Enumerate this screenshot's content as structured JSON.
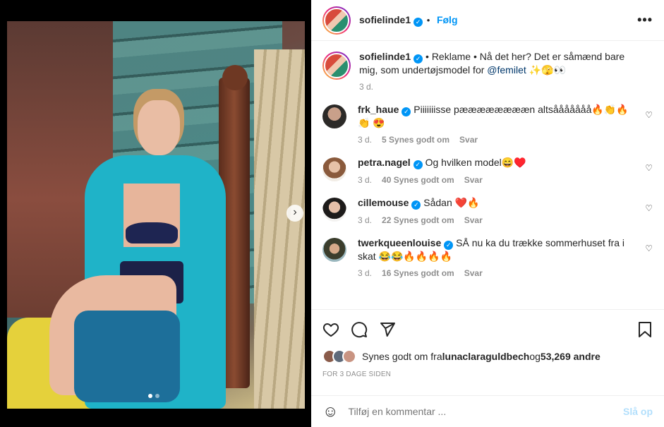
{
  "post": {
    "author": "sofielinde1",
    "follow_label": "Følg",
    "more_label": "•••",
    "caption_prefix": "• Reklame • Nå det her? Det er såmænd bare mig, som undertøjsmodel for ",
    "caption_mention": "@femilet",
    "caption_suffix": " ✨🫣👀",
    "caption_time": "3 d."
  },
  "comments": [
    {
      "user": "frk_haue",
      "text": "Piiiiiiisse pææææææææn altsååååååå🔥👏🔥👏 😍",
      "time": "3 d.",
      "likes": "5 Synes godt om",
      "reply": "Svar"
    },
    {
      "user": "petra.nagel",
      "text": "Og hvilken model😄♥️",
      "time": "3 d.",
      "likes": "40 Synes godt om",
      "reply": "Svar"
    },
    {
      "user": "cillemouse",
      "text": "Sådan ❤️🔥",
      "time": "3 d.",
      "likes": "22 Synes godt om",
      "reply": "Svar"
    },
    {
      "user": "twerkqueenlouise",
      "text": "SÅ nu ka du trække sommerhuset fra i skat 😂😂🔥🔥🔥🔥",
      "time": "3 d.",
      "likes": "16 Synes godt om",
      "reply": "Svar"
    }
  ],
  "likes": {
    "prefix": "Synes godt om fra ",
    "first_liker": "lunaclaraguldbech",
    "middle": " og ",
    "others": "53,269 andre"
  },
  "time_ago": "FOR 3 DAGE SIDEN",
  "add_comment": {
    "placeholder": "Tilføj en kommentar ...",
    "post_label": "Slå op"
  },
  "media": {
    "next_glyph": "›",
    "slide_count": 2,
    "active_slide": 1
  },
  "colors": {
    "link_blue": "#0095f6",
    "mention": "#00376b",
    "muted": "#8e8e8e"
  }
}
